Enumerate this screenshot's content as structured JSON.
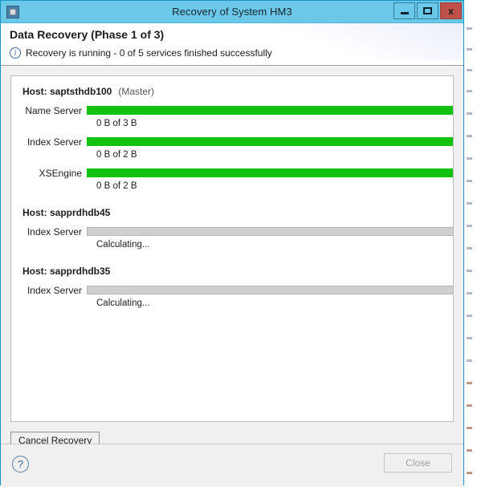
{
  "window": {
    "title": "Recovery of System HM3",
    "icon": "window-app-icon",
    "controls": {
      "minimize": "minimize-icon",
      "maximize": "maximize-icon",
      "close": "x"
    }
  },
  "header": {
    "title": "Data Recovery (Phase 1 of 3)",
    "status_icon": "i",
    "status_text": "Recovery is running - 0 of 5 services finished successfully"
  },
  "hosts": [
    {
      "heading": "Host: saptsthdb100",
      "role": "(Master)",
      "services": [
        {
          "label": "Name Server",
          "state": "done",
          "detail": "0 B of 3 B"
        },
        {
          "label": "Index Server",
          "state": "done",
          "detail": "0 B of 2 B"
        },
        {
          "label": "XSEngine",
          "state": "done",
          "detail": "0 B of 2 B"
        }
      ]
    },
    {
      "heading": "Host: sapprdhdb45",
      "role": "",
      "services": [
        {
          "label": "Index Server",
          "state": "idle",
          "detail": "Calculating..."
        }
      ]
    },
    {
      "heading": "Host: sapprdhdb35",
      "role": "",
      "services": [
        {
          "label": "Index Server",
          "state": "idle",
          "detail": "Calculating..."
        }
      ]
    }
  ],
  "buttons": {
    "cancel_recovery": "Cancel Recovery",
    "help": "?",
    "close": "Close"
  },
  "colors": {
    "title_bar": "#6cc8e8",
    "close_button": "#c0504a",
    "progress_done": "#11c211",
    "progress_idle": "#cfcfcf",
    "info_icon": "#3d6ea8"
  }
}
